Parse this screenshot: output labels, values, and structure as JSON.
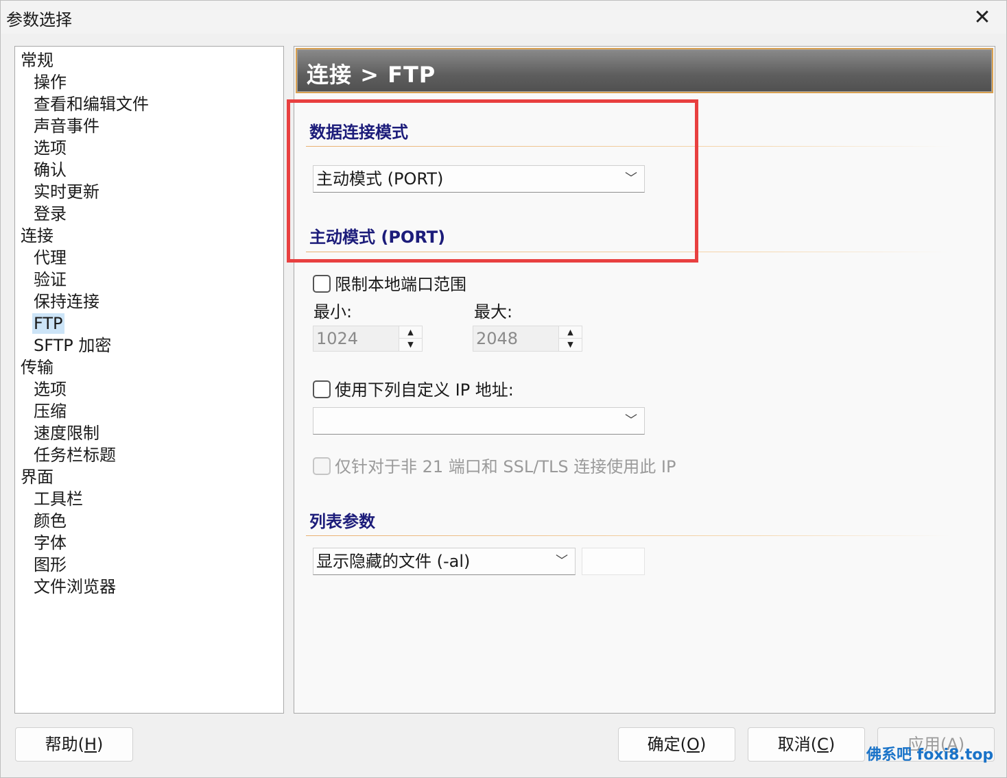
{
  "window": {
    "title": "参数选择",
    "close_glyph": "✕"
  },
  "tree": {
    "items": [
      {
        "label": "常规",
        "level": 0
      },
      {
        "label": "操作",
        "level": 1
      },
      {
        "label": "查看和编辑文件",
        "level": 1
      },
      {
        "label": "声音事件",
        "level": 1
      },
      {
        "label": "选项",
        "level": 1
      },
      {
        "label": "确认",
        "level": 1
      },
      {
        "label": "实时更新",
        "level": 1
      },
      {
        "label": "登录",
        "level": 1
      },
      {
        "label": "连接",
        "level": 0
      },
      {
        "label": "代理",
        "level": 1
      },
      {
        "label": "验证",
        "level": 1
      },
      {
        "label": "保持连接",
        "level": 1
      },
      {
        "label": "FTP",
        "level": 1,
        "selected": true
      },
      {
        "label": "SFTP 加密",
        "level": 1
      },
      {
        "label": "传输",
        "level": 0
      },
      {
        "label": "选项",
        "level": 1
      },
      {
        "label": "压缩",
        "level": 1
      },
      {
        "label": "速度限制",
        "level": 1
      },
      {
        "label": "任务栏标题",
        "level": 1
      },
      {
        "label": "界面",
        "level": 0
      },
      {
        "label": "工具栏",
        "level": 1
      },
      {
        "label": "颜色",
        "level": 1
      },
      {
        "label": "字体",
        "level": 1
      },
      {
        "label": "图形",
        "level": 1
      },
      {
        "label": "文件浏览器",
        "level": 1
      }
    ]
  },
  "panel": {
    "header": "连接 > FTP",
    "data_mode": {
      "title": "数据连接模式",
      "selected": "主动模式 (PORT)"
    },
    "active_mode": {
      "title": "主动模式 (PORT)",
      "limit_ports_label": "限制本地端口范围",
      "limit_ports_checked": false,
      "min_label": "最小:",
      "min_value": "1024",
      "max_label": "最大:",
      "max_value": "2048",
      "custom_ip_label": "使用下列自定义 IP 地址:",
      "custom_ip_checked": false,
      "custom_ip_value": "",
      "non21_label": "仅针对于非 21 端口和 SSL/TLS 连接使用此 IP",
      "non21_disabled": true
    },
    "list_params": {
      "title": "列表参数",
      "selected": "显示隐藏的文件 (-al)",
      "extra_value": ""
    }
  },
  "buttons": {
    "help": {
      "text": "帮助(",
      "key": "H",
      "end": ")"
    },
    "ok": {
      "text": "确定(",
      "key": "O",
      "end": ")"
    },
    "cancel": {
      "text": "取消(",
      "key": "C",
      "end": ")"
    },
    "apply": {
      "text": "应用(",
      "key": "A",
      "end": ")"
    }
  },
  "watermark": "佛系吧  foxi8.top",
  "colors": {
    "section_title": "#1c1c7a",
    "highlight": "#e84040",
    "selected_item": "#cce4f7",
    "header_border": "#d8a050"
  }
}
